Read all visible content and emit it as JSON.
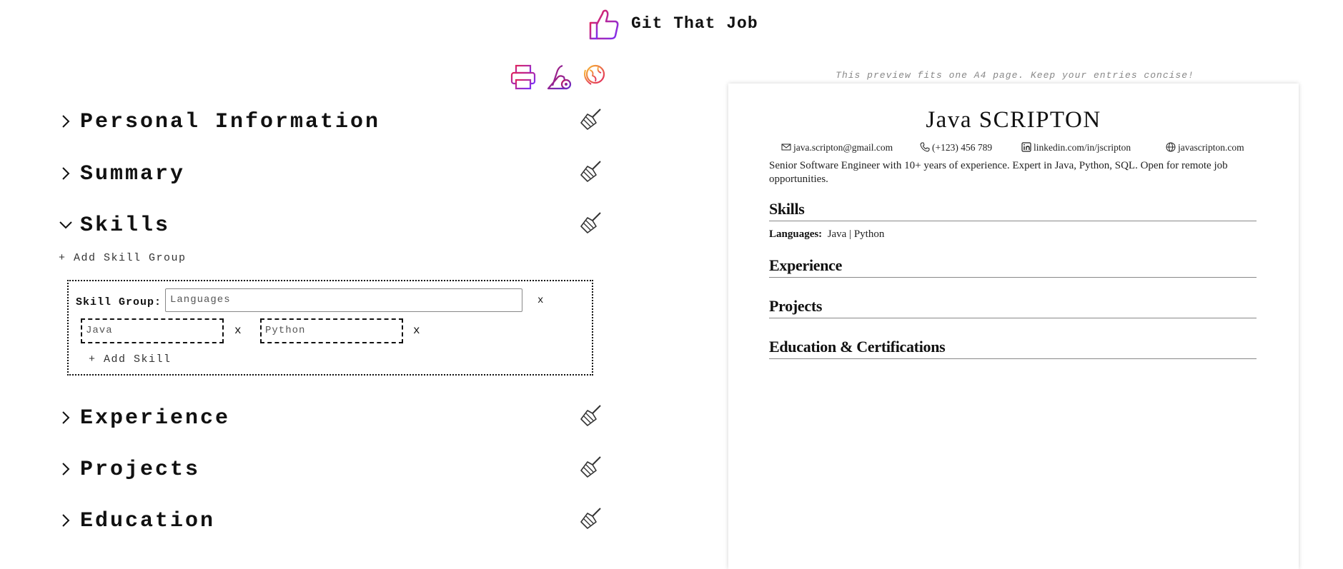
{
  "app": {
    "title": "Git That Job"
  },
  "toolbar": {
    "icons": [
      "printer-icon",
      "vacuum-icon",
      "globe-icon"
    ],
    "colors": {
      "gradient_start": "#7b2ff7",
      "gradient_end": "#f7b733"
    }
  },
  "editor": {
    "sections": [
      {
        "title": "Personal Information",
        "expanded": false
      },
      {
        "title": "Summary",
        "expanded": false
      },
      {
        "title": "Skills",
        "expanded": true
      },
      {
        "title": "Experience",
        "expanded": false
      },
      {
        "title": "Projects",
        "expanded": false
      },
      {
        "title": "Education",
        "expanded": false
      }
    ],
    "skills": {
      "add_group_label": "+ Add Skill Group",
      "group_label": "Skill Group:",
      "group_value": "Languages",
      "remove_label": "x",
      "items": [
        {
          "value": "Java",
          "remove": "x"
        },
        {
          "value": "Python",
          "remove": "x"
        }
      ],
      "add_skill_label": "+ Add Skill"
    }
  },
  "preview": {
    "note": "This preview fits one A4 page. Keep your entries concise!",
    "name": "Java SCRIPTON",
    "contacts": {
      "email": "java.scripton@gmail.com",
      "phone": "(+123) 456 789",
      "linkedin": "linkedin.com/in/jscripton",
      "website": "javascripton.com"
    },
    "summary": "Senior Software Engineer with 10+ years of experience. Expert in Java, Python, SQL. Open for remote job opportunities.",
    "headings": {
      "skills": "Skills",
      "experience": "Experience",
      "projects": "Projects",
      "education": "Education & Certifications"
    },
    "skill_row": {
      "label": "Languages:",
      "values": "Java | Python"
    }
  }
}
